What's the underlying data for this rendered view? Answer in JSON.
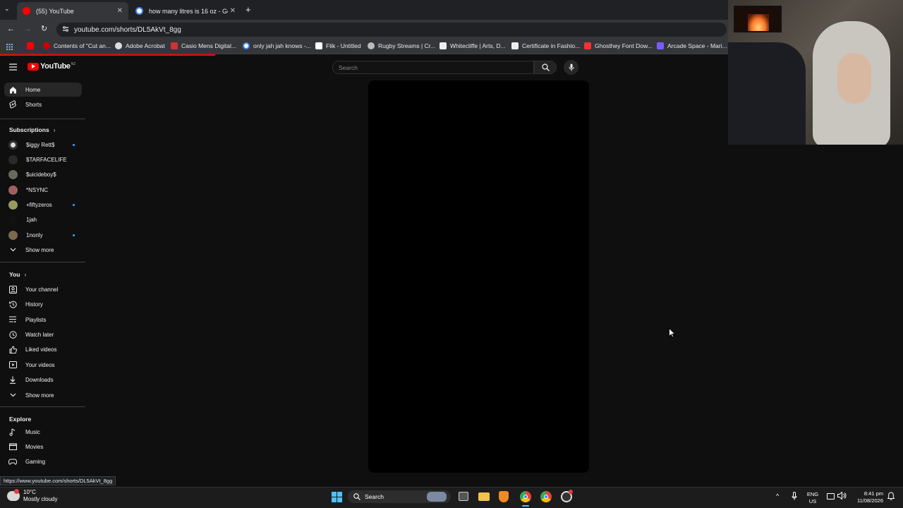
{
  "browser": {
    "tabs": [
      {
        "title": "(55) YouTube",
        "active": true
      },
      {
        "title": "how many litres is 16 oz - Goog",
        "active": false
      }
    ],
    "url": "youtube.com/shorts/DL5AkVt_8gg",
    "status_url": "https://www.youtube.com/shorts/DL5AkVt_8gg",
    "bookmarks": [
      "Contents of \"Cut an...",
      "Adobe Acrobat",
      "Casio Mens Digital...",
      "only jah jah knows -...",
      "Flik - Untitled",
      "Rugby Streams | Cr...",
      "Whitecliffe | Arts, D...",
      "Certificate in Fashio...",
      "Ghosthey Font Dow...",
      "Arcade Space - Mari..."
    ]
  },
  "youtube": {
    "logo": "YouTube",
    "region": "NZ",
    "search_placeholder": "Search",
    "nav": [
      {
        "label": "Home",
        "icon": "home-icon"
      },
      {
        "label": "Shorts",
        "icon": "shorts-icon"
      }
    ],
    "subscriptions_title": "Subscriptions",
    "subscriptions": [
      {
        "label": "$iggy Rett$",
        "new": true
      },
      {
        "label": "$TARFACELIFE",
        "new": false
      },
      {
        "label": "$uicideboy$",
        "new": false
      },
      {
        "label": "*NSYNC",
        "new": false
      },
      {
        "label": "+fiftyzeros",
        "new": true
      },
      {
        "label": "1jah",
        "new": false
      },
      {
        "label": "1nonly",
        "new": true
      }
    ],
    "show_more": "Show more",
    "you_title": "You",
    "you_items": [
      {
        "label": "Your channel",
        "icon": "account-icon"
      },
      {
        "label": "History",
        "icon": "history-icon"
      },
      {
        "label": "Playlists",
        "icon": "playlists-icon"
      },
      {
        "label": "Watch later",
        "icon": "clock-icon"
      },
      {
        "label": "Liked videos",
        "icon": "thumbs-up-icon"
      },
      {
        "label": "Your videos",
        "icon": "video-icon"
      },
      {
        "label": "Downloads",
        "icon": "download-icon"
      }
    ],
    "show_more_2": "Show more",
    "explore_title": "Explore",
    "explore_items": [
      {
        "label": "Music",
        "icon": "music-icon"
      },
      {
        "label": "Movies",
        "icon": "movies-icon"
      },
      {
        "label": "Gaming",
        "icon": "gaming-icon"
      }
    ]
  },
  "taskbar": {
    "weather_temp": "10°C",
    "weather_desc": "Mostly cloudy",
    "search_label": "Search",
    "lang_top": "ENG",
    "lang_bottom": "US",
    "time": "8:41 pm",
    "date": "11/08/2026"
  }
}
